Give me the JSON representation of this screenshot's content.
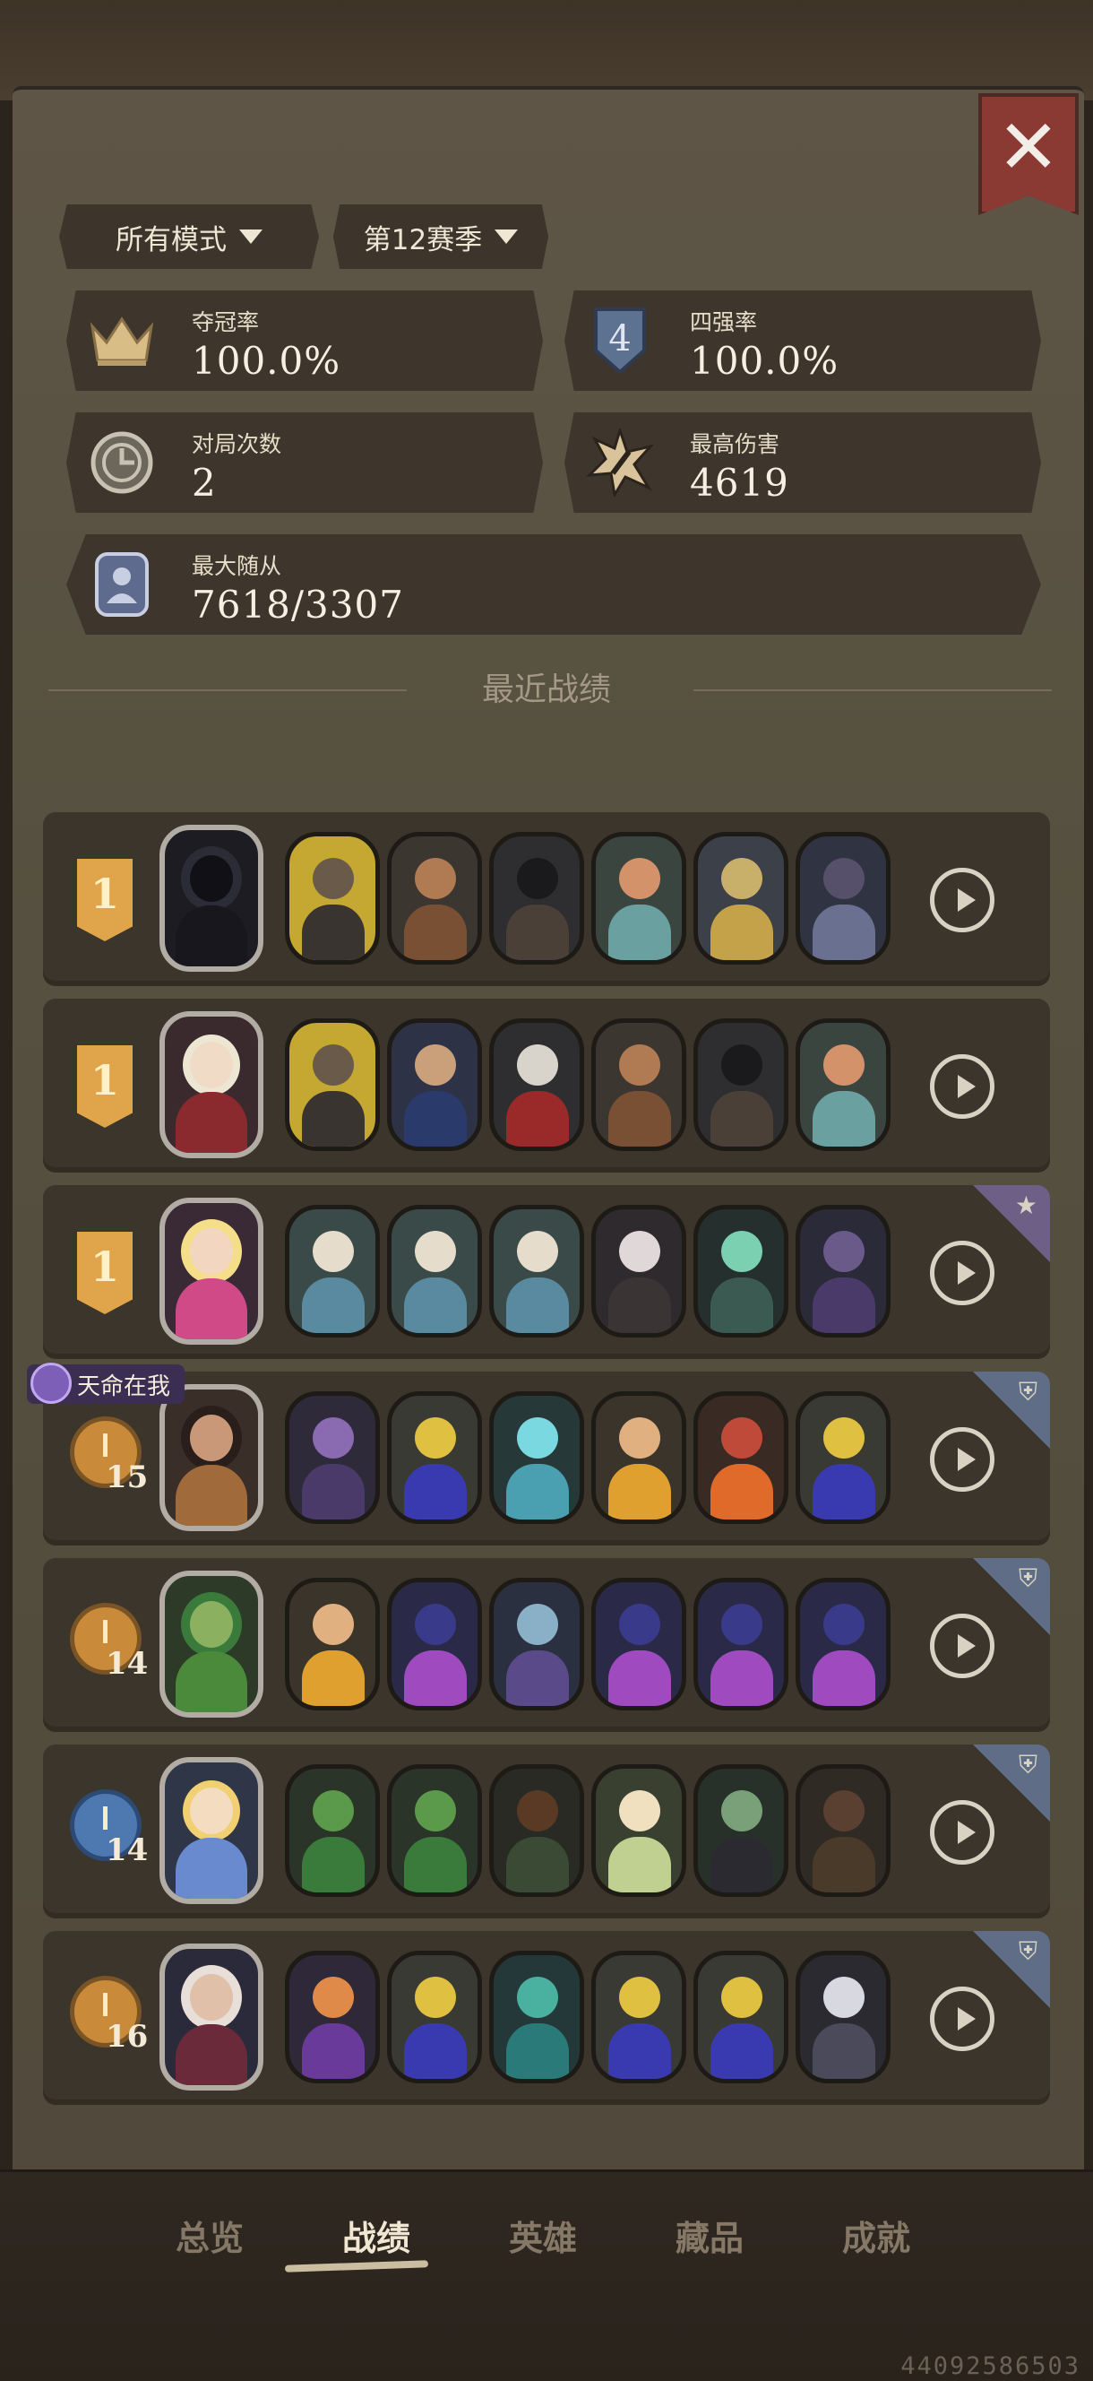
{
  "header": {
    "close_icon": "close-icon"
  },
  "filters": {
    "mode_label": "所有模式",
    "season_label": "第12赛季"
  },
  "stats": {
    "win_rate_label": "夺冠率",
    "win_rate_value": "100.0%",
    "top4_label": "四强率",
    "top4_value": "100.0%",
    "games_label": "对局次数",
    "games_value": "2",
    "max_damage_label": "最高伤害",
    "max_damage_value": "4619",
    "max_minion_label": "最大随从",
    "max_minion_value": "7618/3307"
  },
  "recent": {
    "title": "最近战绩",
    "fate_tag": "天命在我",
    "matches": [
      {
        "result_type": "rank",
        "result": "1"
      },
      {
        "result_type": "rank",
        "result": "1"
      },
      {
        "result_type": "rank",
        "result": "1"
      },
      {
        "result_type": "turns",
        "result": "15"
      },
      {
        "result_type": "turns",
        "result": "14"
      },
      {
        "result_type": "turns",
        "result": "14"
      },
      {
        "result_type": "turns",
        "result": "16"
      }
    ]
  },
  "tabs": {
    "overview": "总览",
    "records": "战绩",
    "heroes": "英雄",
    "collection": "藏品",
    "achievements": "成就"
  },
  "footer": {
    "uid": "44092586503"
  },
  "colors": {
    "accent_gold": "#e0a54a",
    "close_red": "#8a3a32",
    "panel": "#5e5546"
  }
}
